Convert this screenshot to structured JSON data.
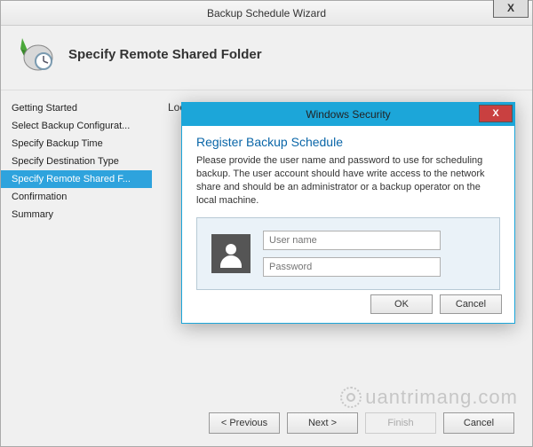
{
  "window": {
    "title": "Backup Schedule Wizard",
    "close_glyph": "X"
  },
  "header": {
    "title": "Specify Remote Shared Folder"
  },
  "sidebar": {
    "items": [
      {
        "label": "Getting Started"
      },
      {
        "label": "Select Backup Configurat..."
      },
      {
        "label": "Specify Backup Time"
      },
      {
        "label": "Specify Destination Type"
      },
      {
        "label": "Specify Remote Shared F..."
      },
      {
        "label": "Confirmation"
      },
      {
        "label": "Summary"
      }
    ],
    "selected_index": 4
  },
  "main": {
    "location_label": "Location:"
  },
  "footer": {
    "previous": "< Previous",
    "next": "Next >",
    "finish": "Finish",
    "cancel": "Cancel"
  },
  "dialog": {
    "title": "Windows Security",
    "close_glyph": "X",
    "heading": "Register Backup Schedule",
    "text": "Please provide the user name and password to use for scheduling backup. The user account should have write access to the network share and should be an administrator or a backup operator on the local machine.",
    "username_placeholder": "User name",
    "password_placeholder": "Password",
    "ok": "OK",
    "cancel": "Cancel"
  },
  "watermark": "uantrimang.com"
}
